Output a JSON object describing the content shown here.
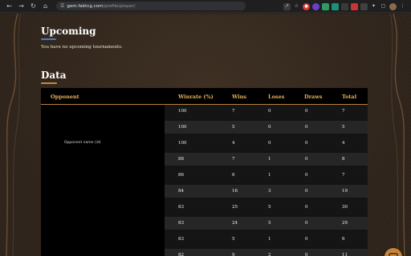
{
  "browser": {
    "url_host": "gem.fabtcg.com",
    "url_path": "/profile/player/"
  },
  "icons": {
    "back": "arrow-left-icon",
    "forward": "arrow-right-icon",
    "reload": "reload-icon",
    "home": "home-icon",
    "site_info": "site-info-icon",
    "share": "share-icon",
    "bookmark": "star-icon",
    "profile": "profile-avatar-icon",
    "menu": "more-vertical-icon",
    "chat": "chat-bubble-icon"
  },
  "upcoming": {
    "title": "Upcoming",
    "empty_message": "You have no upcoming tournaments."
  },
  "data_section": {
    "title": "Data",
    "columns": {
      "opponent": "Opponent",
      "winrate": "Winrate (%)",
      "wins": "Wins",
      "loses": "Loses",
      "draws": "Draws",
      "total": "Total"
    },
    "opponent_placeholder": "Opponent name (id)",
    "rows": [
      {
        "winrate": "100",
        "wins": "7",
        "loses": "0",
        "draws": "0",
        "total": "7"
      },
      {
        "winrate": "100",
        "wins": "5",
        "loses": "0",
        "draws": "0",
        "total": "5"
      },
      {
        "winrate": "100",
        "wins": "4",
        "loses": "0",
        "draws": "0",
        "total": "4"
      },
      {
        "winrate": "88",
        "wins": "7",
        "loses": "1",
        "draws": "0",
        "total": "8"
      },
      {
        "winrate": "86",
        "wins": "6",
        "loses": "1",
        "draws": "0",
        "total": "7"
      },
      {
        "winrate": "84",
        "wins": "16",
        "loses": "3",
        "draws": "0",
        "total": "19"
      },
      {
        "winrate": "83",
        "wins": "25",
        "loses": "5",
        "draws": "0",
        "total": "30"
      },
      {
        "winrate": "83",
        "wins": "24",
        "loses": "5",
        "draws": "0",
        "total": "29"
      },
      {
        "winrate": "83",
        "wins": "5",
        "loses": "1",
        "draws": "0",
        "total": "6"
      },
      {
        "winrate": "82",
        "wins": "9",
        "loses": "2",
        "draws": "0",
        "total": "11"
      }
    ]
  },
  "colors": {
    "accent_gold": "#e7b25a",
    "upcoming_underline": "#3d7fd0",
    "data_underline": "#c58a3e",
    "chat_button": "#c8843a"
  }
}
